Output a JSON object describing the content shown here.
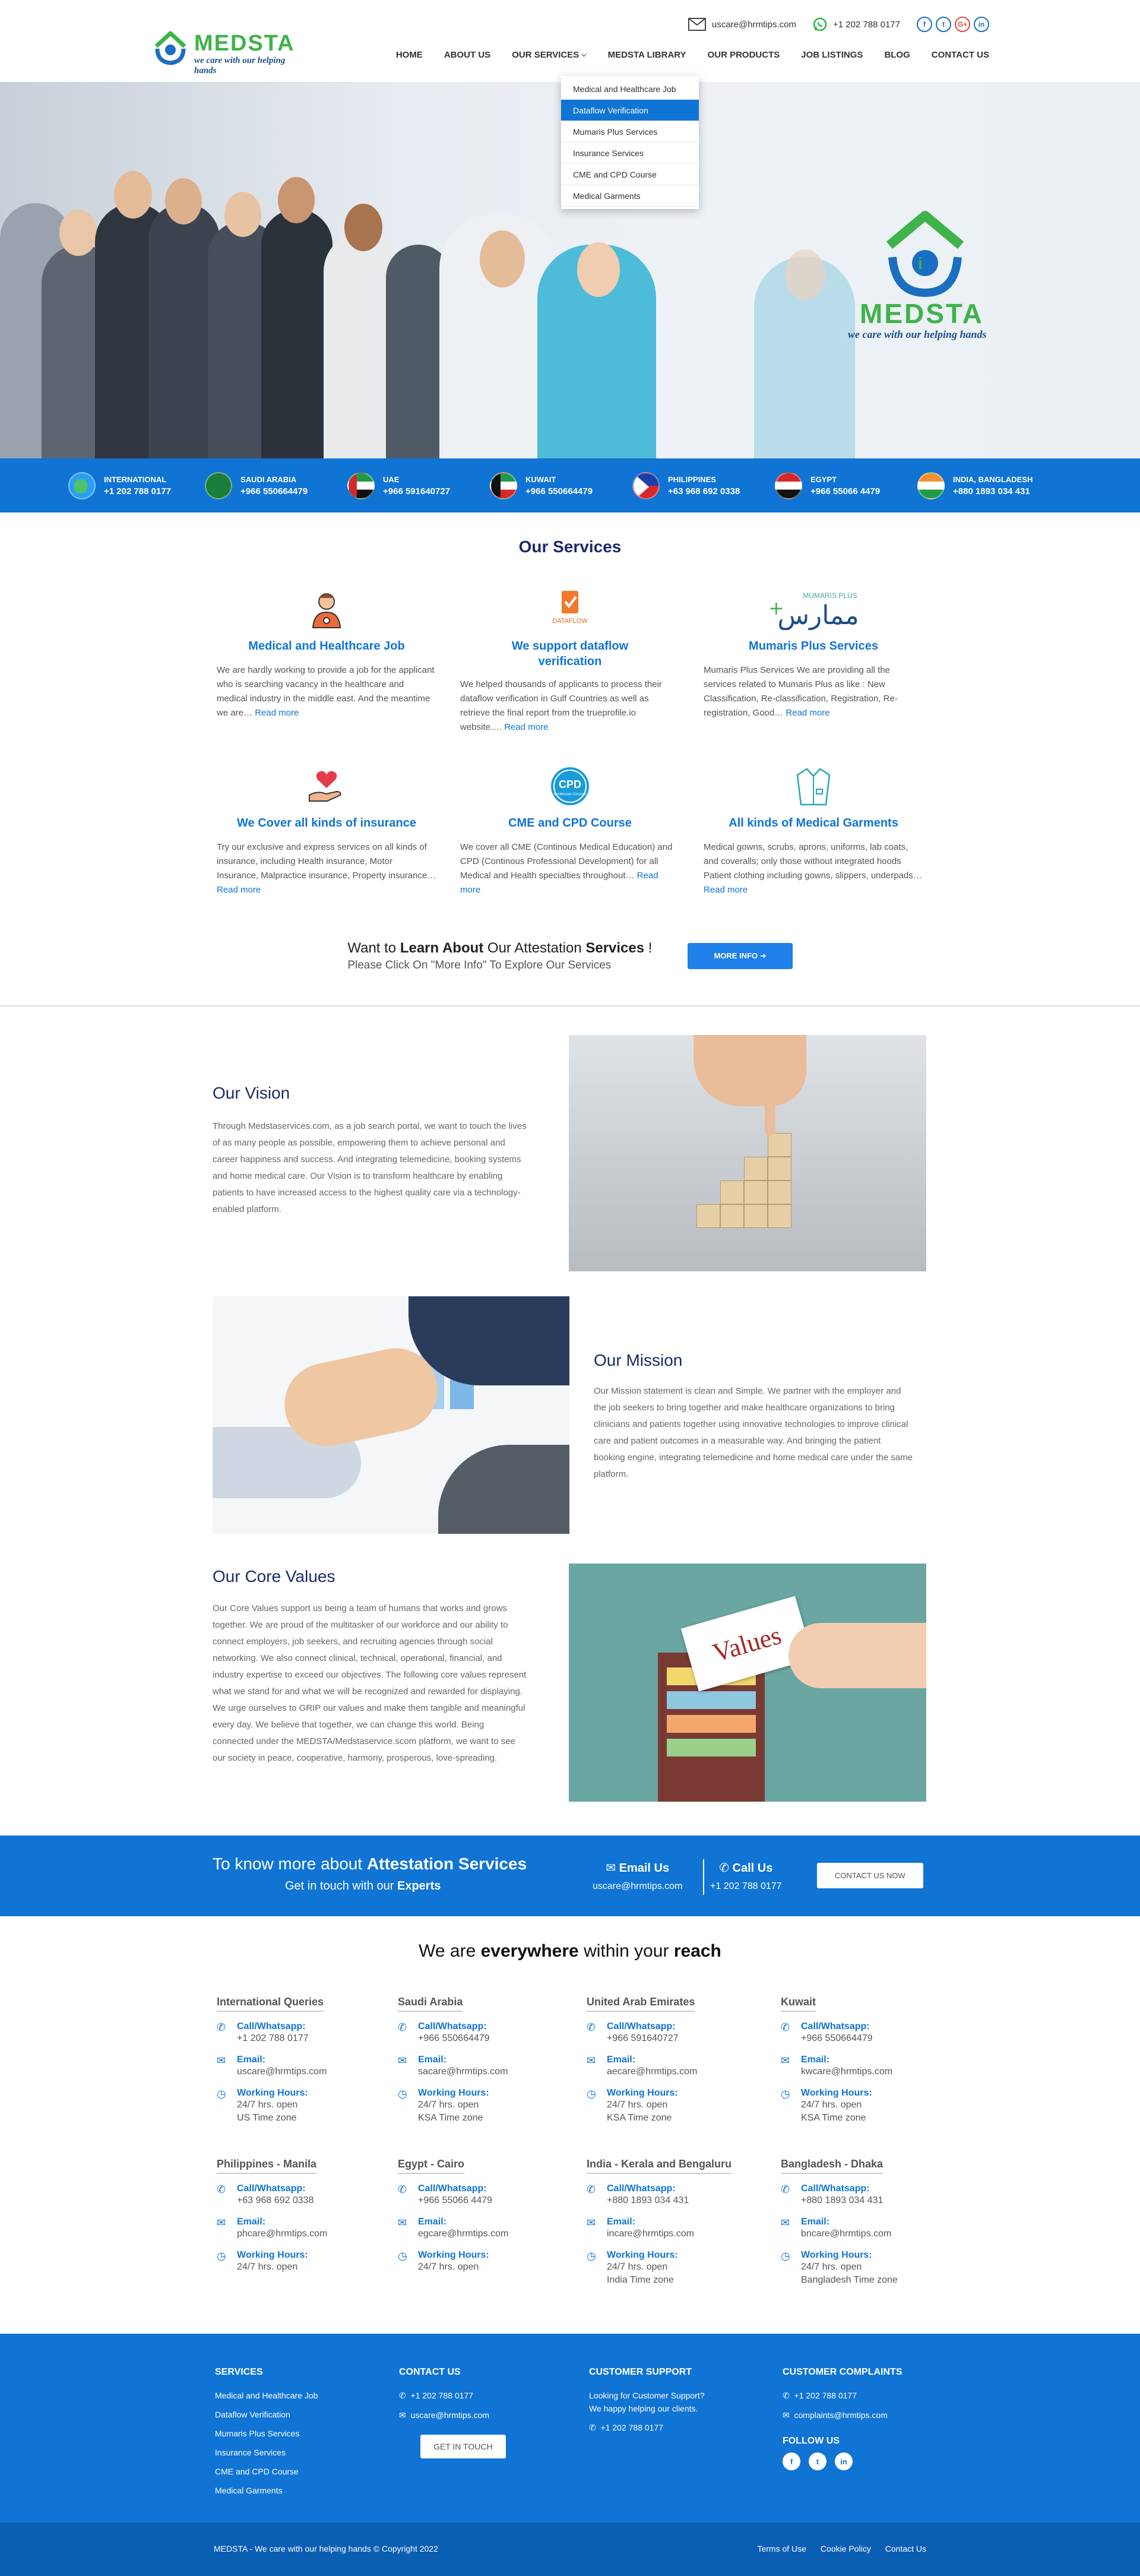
{
  "header": {
    "logo_name": "MEDSTA",
    "logo_tagline": "we care with our helping hands",
    "email": "uscare@hrmtips.com",
    "whatsapp": "+1 202 788 0177",
    "social": [
      "f",
      "t",
      "G+",
      "in"
    ],
    "nav": [
      "HOME",
      "ABOUT US",
      "OUR SERVICES",
      "MEDSTA LIBRARY",
      "OUR PRODUCTS",
      "JOB LISTINGS",
      "BLOG",
      "CONTACT US"
    ],
    "dropdown": [
      "Medical and Healthcare Job",
      "Dataflow Verification",
      "Mumaris Plus Services",
      "Insurance Services",
      "CME and CPD Course",
      "Medical Garments"
    ]
  },
  "hero": {
    "logo_name": "MEDSTA",
    "logo_tagline": "we care with our helping hands"
  },
  "phones": [
    {
      "country": "INTERNATIONAL",
      "number": "+1 202 788 0177"
    },
    {
      "country": "SAUDI ARABIA",
      "number": "+966 550664479"
    },
    {
      "country": "UAE",
      "number": "+966 591640727"
    },
    {
      "country": "KUWAIT",
      "number": "+966 550664479"
    },
    {
      "country": "PHILIPPINES",
      "number": "+63 968 692 0338"
    },
    {
      "country": "EGYPT",
      "number": "+966 55066 4479"
    },
    {
      "country": "INDIA, BANGLADESH",
      "number": "+880 1893 034 431"
    }
  ],
  "services": {
    "title": "Our Services",
    "read_more": "Read more",
    "items": [
      {
        "title": "Medical and Healthcare Job",
        "text": "We are hardly working to provide a job for the applicant who is searching vacancy in the healthcare and medical industry in the middle east. And the meantime we are… "
      },
      {
        "title": "We support dataflow verification",
        "text": "We helped thousands of applicants to process their dataflow verification in Gulf Countries as well as retrieve the final report from the trueprofile.io website…. "
      },
      {
        "title": "Mumaris Plus Services",
        "text": "Mumaris Plus Services We are providing all the services related to Mumaris Plus as like : New Classification, Re-classification, Registration, Re-registration, Good… "
      },
      {
        "title": "We Cover all kinds of insurance",
        "text": "Try our exclusive and express services on all kinds of insurance, including Health insurance, Motor Insurance, Malpractice insurance, Property insurance… "
      },
      {
        "title": "CME and CPD Course",
        "text": "We cover all CME (Continous Medical Education) and CPD (Continous Professional Development) for all Medical and Health specialties throughout… "
      },
      {
        "title": "All kinds of Medical Garments",
        "text": "Medical gowns, scrubs, aprons, uniforms, lab coats, and coveralls; only those without integrated hoods Patient clothing including gowns, slippers, underpads… "
      }
    ],
    "icon_labels": {
      "dataflow": "DATAFLOW",
      "mumaris": "MUMARIS PLUS",
      "mumaris_ar": "ممارس",
      "cpd": "CPD",
      "cpd_sub": "Continuous Courses"
    }
  },
  "attest": {
    "line1_a": "Want to ",
    "line1_b": "Learn About",
    "line1_c": " Our Attestation ",
    "line1_d": "Services",
    "line1_e": " !",
    "line2": "Please Click On \"More Info\" To Explore Our Services",
    "button": "MORE INFO"
  },
  "vision": {
    "title": "Our Vision",
    "text": "Through Medstaservices.com, as a job search portal, we want to touch the lives of as many people as possible, empowering them to achieve personal and career happiness and success. And integrating telemedicine, booking systems and home medical care. Our Vision is to transform healthcare by enabling patients to have increased access to the highest quality care via a technology-enabled platform."
  },
  "mission": {
    "title": "Our Mission",
    "text": "Our Mission statement is clean and Simple. We partner with the employer and the job seekers to bring together and make healthcare organizations to bring clinicians and patients together using innovative technologies to improve clinical care and patient outcomes in a measurable way. And bringing the patient booking engine, integrating telemedicine and home medical care under the same platform."
  },
  "values": {
    "title": "Our Core Values",
    "card_text": "Values",
    "text": "Our Core Values support us being a team of humans  that works and grows together. We are proud of the multitasker of our workforce and our ability to connect employers, job seekers, and recruiting agencies through social networking. We also connect clinical, technical, operational, financial, and industry expertise to exceed our objectives. The following core values represent what we stand for and what we will be recognized and rewarded for displaying. We urge ourselves to GRIP our values and make them tangible and meaningful every day. We believe that together, we can change this world. Being connected under the MEDSTA/Medstaservice.scom platform, we want to see our society in peace, cooperative, harmony, prosperous, love-spreading."
  },
  "cta": {
    "line1_a": "To know more about ",
    "line1_b": "Attestation Services",
    "line2_a": "Get in touch with our ",
    "line2_b": "Experts",
    "email_label": "Email Us",
    "email": "uscare@hrmtips.com",
    "call_label": "Call Us",
    "call": "+1 202 788 0177",
    "button": "CONTACT US NOW"
  },
  "reach": {
    "title_a": "We are ",
    "title_b": "everywhere",
    "title_c": " within your ",
    "title_d": "reach",
    "labels": {
      "call": "Call/Whatsapp:",
      "email": "Email:",
      "hours": "Working Hours:"
    },
    "offices": [
      {
        "name": "International Queries",
        "phone": "+1 202 788 0177",
        "email": "uscare@hrmtips.com",
        "hours": [
          "24/7 hrs. open",
          "US Time zone"
        ]
      },
      {
        "name": "Saudi Arabia",
        "phone": "+966 550664479",
        "email": "sacare@hrmtips.com",
        "hours": [
          "24/7 hrs. open",
          "KSA Time zone"
        ]
      },
      {
        "name": "United Arab Emirates",
        "phone": "+966 591640727",
        "email": "aecare@hrmtips.com",
        "hours": [
          "24/7 hrs. open",
          "KSA Time zone"
        ]
      },
      {
        "name": "Kuwait",
        "phone": "+966 550664479",
        "email": "kwcare@hrmtips.com",
        "hours": [
          "24/7 hrs. open",
          "KSA Time zone"
        ]
      },
      {
        "name": "Philippines - Manila",
        "phone": "+63 968 692 0338",
        "email": "phcare@hrmtips.com",
        "hours": [
          "24/7 hrs. open"
        ]
      },
      {
        "name": "Egypt - Cairo",
        "phone": "+966 55066 4479",
        "email": "egcare@hrmtips.com",
        "hours": [
          "24/7 hrs. open"
        ]
      },
      {
        "name": "India - Kerala and Bengaluru",
        "phone": "+880 1893 034 431",
        "email": "incare@hrmtips.com",
        "hours": [
          "24/7 hrs. open",
          "India Time zone"
        ]
      },
      {
        "name": "Bangladesh - Dhaka",
        "phone": "+880 1893 034 431",
        "email": "bncare@hrmtips.com",
        "hours": [
          "24/7 hrs. open",
          "Bangladesh Time zone"
        ]
      }
    ]
  },
  "footer": {
    "services_title": "SERVICES",
    "services": [
      "Medical and Healthcare Job",
      "Dataflow Verification",
      "Mumaris Plus Services",
      "Insurance Services",
      "CME and CPD Course",
      "Medical Garments"
    ],
    "contact_title": "CONTACT US",
    "contact_phone": "+1 202 788 0177",
    "contact_email": "uscare@hrmtips.com",
    "contact_button": "GET IN TOUCH",
    "support_title": "CUSTOMER SUPPORT",
    "support_text1": "Looking for Customer Support?",
    "support_text2": "We happy helping our clients.",
    "support_phone": "+1 202 788 0177",
    "complaints_title": "CUSTOMER COMPLAINTS",
    "complaints_phone": "+1 202 788 0177",
    "complaints_email": "complaints@hrmtips.com",
    "follow_title": "FOLLOW US",
    "follow": [
      "f",
      "t",
      "in"
    ]
  },
  "bottom": {
    "copyright": "MEDSTA - We care with our helping hands © Copyright 2022",
    "links": [
      "Terms of Use",
      "Cookie Policy",
      "Contact Us"
    ]
  },
  "colors": {
    "primary": "#1074d4",
    "navy": "#1a2a6b",
    "green": "#3fb24a"
  }
}
